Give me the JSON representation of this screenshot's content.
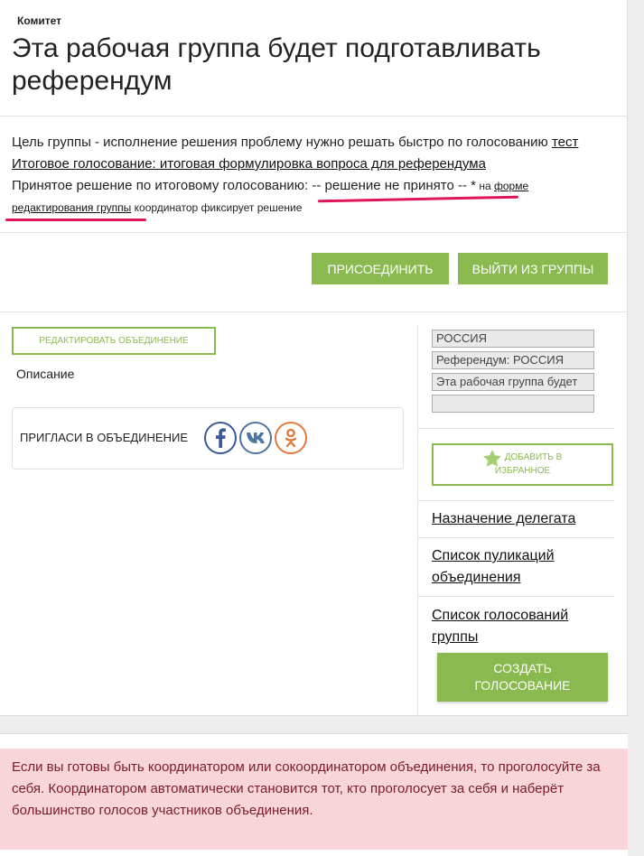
{
  "header": {
    "label": "Комитет",
    "title": "Эта рабочая группа будет подготавливать референдум"
  },
  "info": {
    "goal_prefix": "Цель группы - исполнение решения проблему нужно решать быстро по голосованию ",
    "goal_link": "тест",
    "final_vote_link": "Итоговое голосование: итоговая формулировка вопроса для референдума",
    "decision_prefix": "Принятое решение по итоговому голосованию",
    "decision_value": ": -- решение не принято -- *",
    "decision_mid": " на ",
    "edit_form_link_part1": "форме",
    "edit_form_link_part2": "редактирования группы",
    "decision_suffix": " координатор фиксирует решение"
  },
  "actions": {
    "join_label": "ПРИСОЕДИНИТЬ",
    "leave_label": "ВЫЙТИ ИЗ ГРУППЫ"
  },
  "main": {
    "edit_label": "РЕДАКТИРОВАТЬ ОБЪЕДИНЕНИЕ",
    "description_label": "Описание",
    "share_label": "ПРИГЛАСИ В ОБЪЕДИНЕНИЕ",
    "social": [
      {
        "name": "facebook-icon",
        "color": "#3b5998"
      },
      {
        "name": "vk-icon",
        "color": "#4c75a3"
      },
      {
        "name": "odnoklassniki-icon",
        "color": "#e07a3a"
      }
    ]
  },
  "sidebar": {
    "selects": [
      "РОССИЯ",
      "Референдум: РОССИЯ",
      "Эта рабочая группа будет",
      ""
    ],
    "favorite_line1": "ДОБАВИТЬ В",
    "favorite_line2": "ИЗБРАННОЕ",
    "links": [
      "Назначение делегата",
      "Список пуликаций объединения",
      "Список голосований группы"
    ],
    "create_vote_line1": "СОЗДАТЬ",
    "create_vote_line2": "ГОЛОСОВАНИЕ"
  },
  "notice": {
    "text": "Если вы готовы быть координатором или сокоординатором объединения, то проголосуйте за себя. Координатором автоматически становится тот, кто проголосует за себя и наберёт большинство голосов участников объединения."
  },
  "colors": {
    "accent_green": "#8ab94f",
    "highlight_red": "#e0145a",
    "notice_bg": "#f7d5d9",
    "notice_text": "#7a1c2a"
  }
}
